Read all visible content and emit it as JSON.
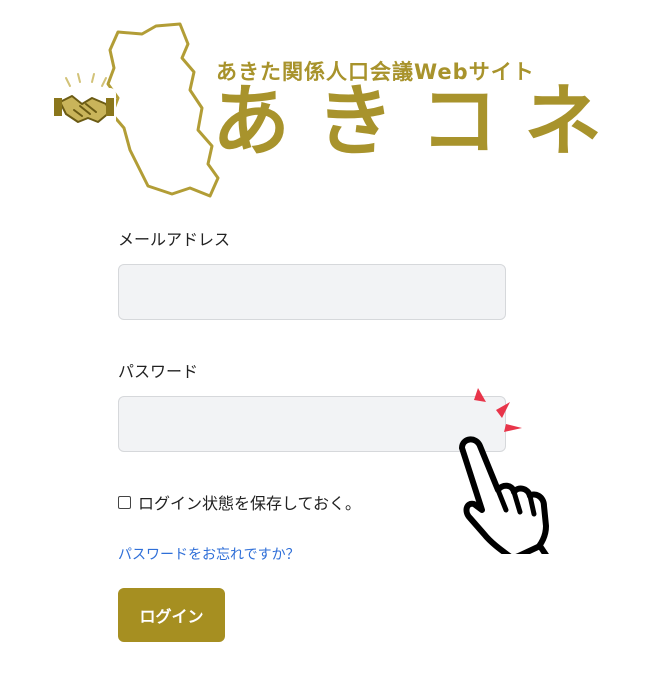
{
  "logo": {
    "subtitle": "あきた関係人口会議Webサイト",
    "title": "あきコネ"
  },
  "form": {
    "email_label": "メールアドレス",
    "email_value": "",
    "password_label": "パスワード",
    "password_value": "",
    "remember_label": "ログイン状態を保存しておく。",
    "remember_checked": false,
    "forgot_link": "パスワードをお忘れですか？",
    "login_button": "ログイン"
  },
  "colors": {
    "brand_gold": "#a8932c",
    "button_gold": "#a68f21",
    "link_blue": "#2f6fd8",
    "spark_red": "#e8354a"
  },
  "icons": {
    "logo_map": "akita-map-outline-icon",
    "handshake": "handshake-icon",
    "pointer": "pointing-hand-icon"
  }
}
